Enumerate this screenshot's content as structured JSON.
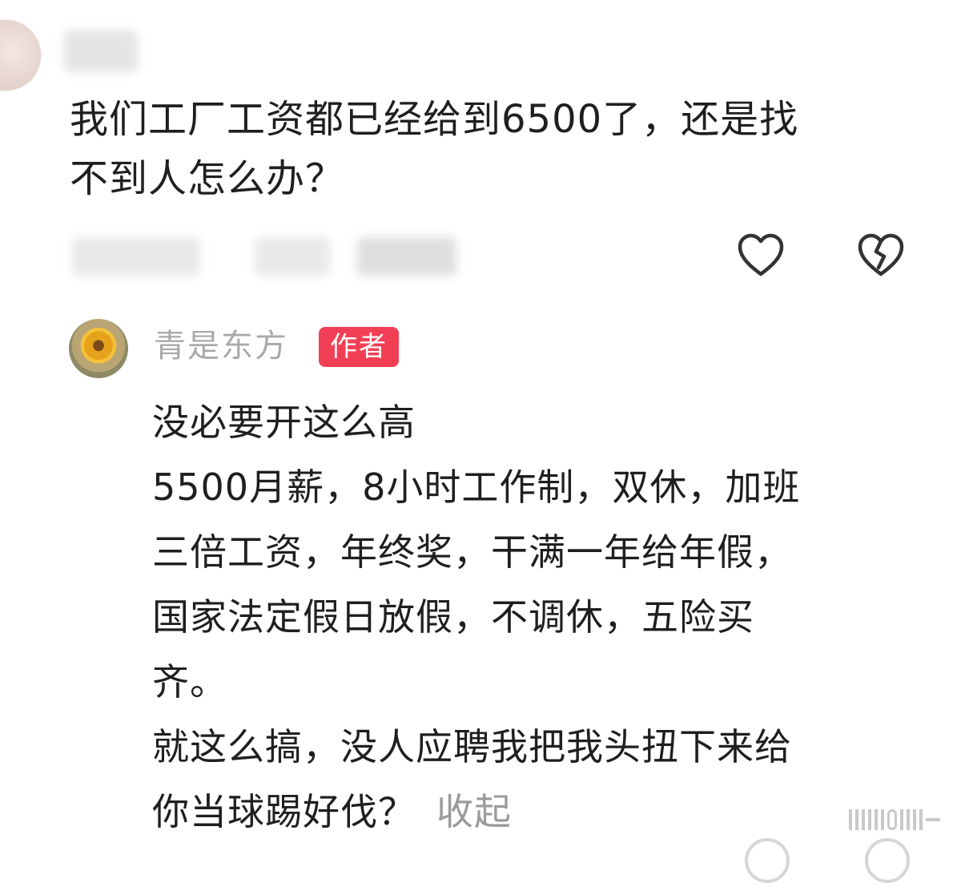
{
  "question": {
    "text": "我们工厂工资都已经给到6500了，还是找\n不到人怎么办？"
  },
  "actions": {
    "like_icon": "heart-outline",
    "dislike_icon": "broken-heart"
  },
  "reply": {
    "author": "青是东方",
    "badge": "作者",
    "lines": [
      "没必要开这么高",
      "5500月薪，8小时工作制，双休，加班",
      "三倍工资，年终奖，干满一年给年假，",
      "国家法定假日放假，不调休，五险买",
      "齐。",
      "就这么搞，没人应聘我把我头扭下来给",
      "你当球踢好伐？"
    ],
    "collapse_label": "收起"
  },
  "colors": {
    "badge": "#f13f55",
    "muted": "#a9a9a9",
    "text": "#1f1f1f"
  }
}
